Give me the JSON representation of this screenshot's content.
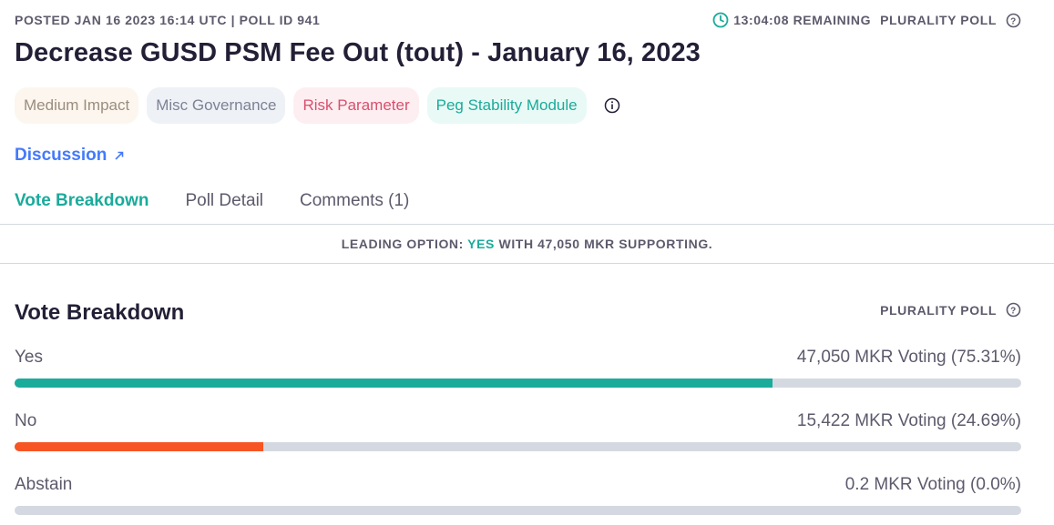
{
  "header": {
    "meta": "POSTED JAN 16 2023 16:14 UTC | POLL ID 941",
    "remaining": "13:04:08 REMAINING",
    "poll_type": "PLURALITY POLL",
    "title": "Decrease GUSD PSM Fee Out (tout) - January 16, 2023"
  },
  "tags": [
    "Medium Impact",
    "Misc Governance",
    "Risk Parameter",
    "Peg Stability Module"
  ],
  "discussion_label": "Discussion",
  "tabs": [
    "Vote Breakdown",
    "Poll Detail",
    "Comments (1)"
  ],
  "leading": {
    "prefix": "LEADING OPTION:",
    "option": "YES",
    "suffix": "WITH 47,050 MKR SUPPORTING."
  },
  "vote_breakdown": {
    "title": "Vote Breakdown",
    "poll_type": "PLURALITY POLL",
    "options": [
      {
        "label": "Yes",
        "value_text": "47,050 MKR Voting (75.31%)",
        "percent": 75.31,
        "color": "#1aab9b"
      },
      {
        "label": "No",
        "value_text": "15,422 MKR Voting (24.69%)",
        "percent": 24.69,
        "color": "#f75524"
      },
      {
        "label": "Abstain",
        "value_text": "0.2 MKR Voting (0.0%)",
        "percent": 0.0,
        "color": "#708390"
      }
    ]
  },
  "colors": {
    "accent": "#1aab9b",
    "link": "#447afb",
    "no": "#f75524",
    "track": "#d4d9e1"
  }
}
